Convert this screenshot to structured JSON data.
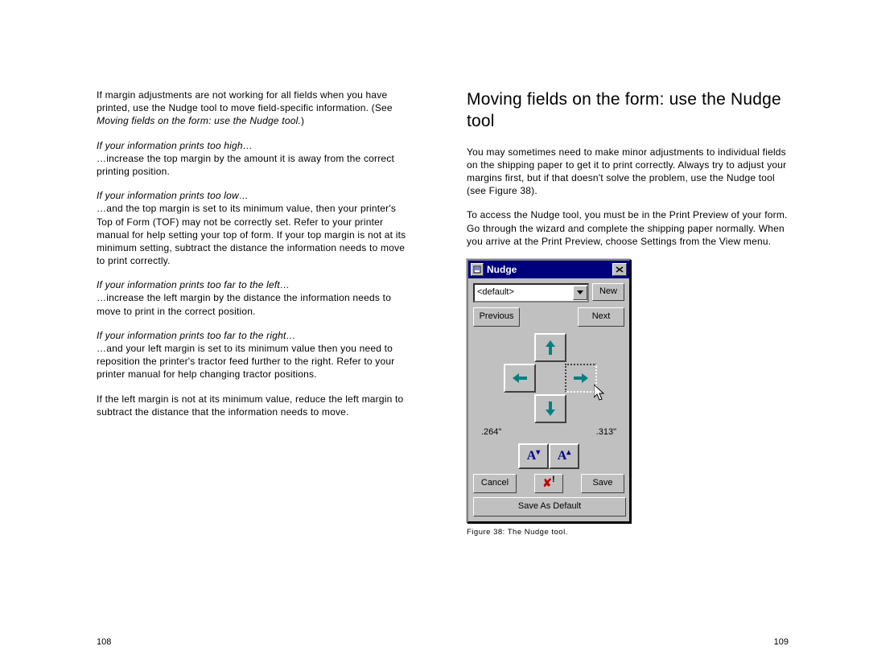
{
  "left": {
    "p1a": "If margin adjustments are not working for all fields when you have printed, use the Nudge tool to move field-specific information. (See ",
    "p1b": "Moving fields on the form: use the Nudge tool.",
    "p1c": ")",
    "h1": "If your information prints too high…",
    "p2": "…increase the top margin by the amount it is away from the correct printing position.",
    "h2": "If your information prints too low…",
    "p3": "…and the top margin is set to its minimum value, then your printer's Top of Form (TOF) may not be correctly set. Refer to your printer manual for help setting your top of form. If your top margin is not at its minimum setting, subtract the distance the information needs to move to print correctly.",
    "h3": "If your information prints too far to the left…",
    "p4": "…increase the left margin by the distance the information needs to move to print in the correct position.",
    "h4": "If your information prints too far to the right…",
    "p5": "…and your left margin is set to its minimum value then you need to reposition the printer's tractor feed further to the right. Refer to your printer manual for help changing tractor positions.",
    "p6": "If the left margin is not at its minimum value, reduce the left margin to subtract the distance that the information needs to move."
  },
  "right": {
    "heading": "Moving fields on the form: use the Nudge tool",
    "p1": "You may sometimes need to make minor adjustments to individual fields on the shipping paper to get it to print correctly. Always try to adjust your margins first, but if that doesn't solve the problem, use the Nudge tool (see Figure 38).",
    "p2": "To access the Nudge tool, you must be in the Print Preview of your form. Go through the wizard and complete the shipping paper normally. When you arrive at the Print Preview, choose Settings from the View menu.",
    "caption": "Figure 38: The Nudge tool."
  },
  "nudge": {
    "title": "Nudge",
    "default": "<default>",
    "new": "New",
    "previous": "Previous",
    "next": "Next",
    "left_val": ".264\"",
    "right_val": ".313\"",
    "cancel": "Cancel",
    "save": "Save",
    "saveDefault": "Save As Default"
  },
  "pages": {
    "left": "108",
    "right": "109"
  }
}
